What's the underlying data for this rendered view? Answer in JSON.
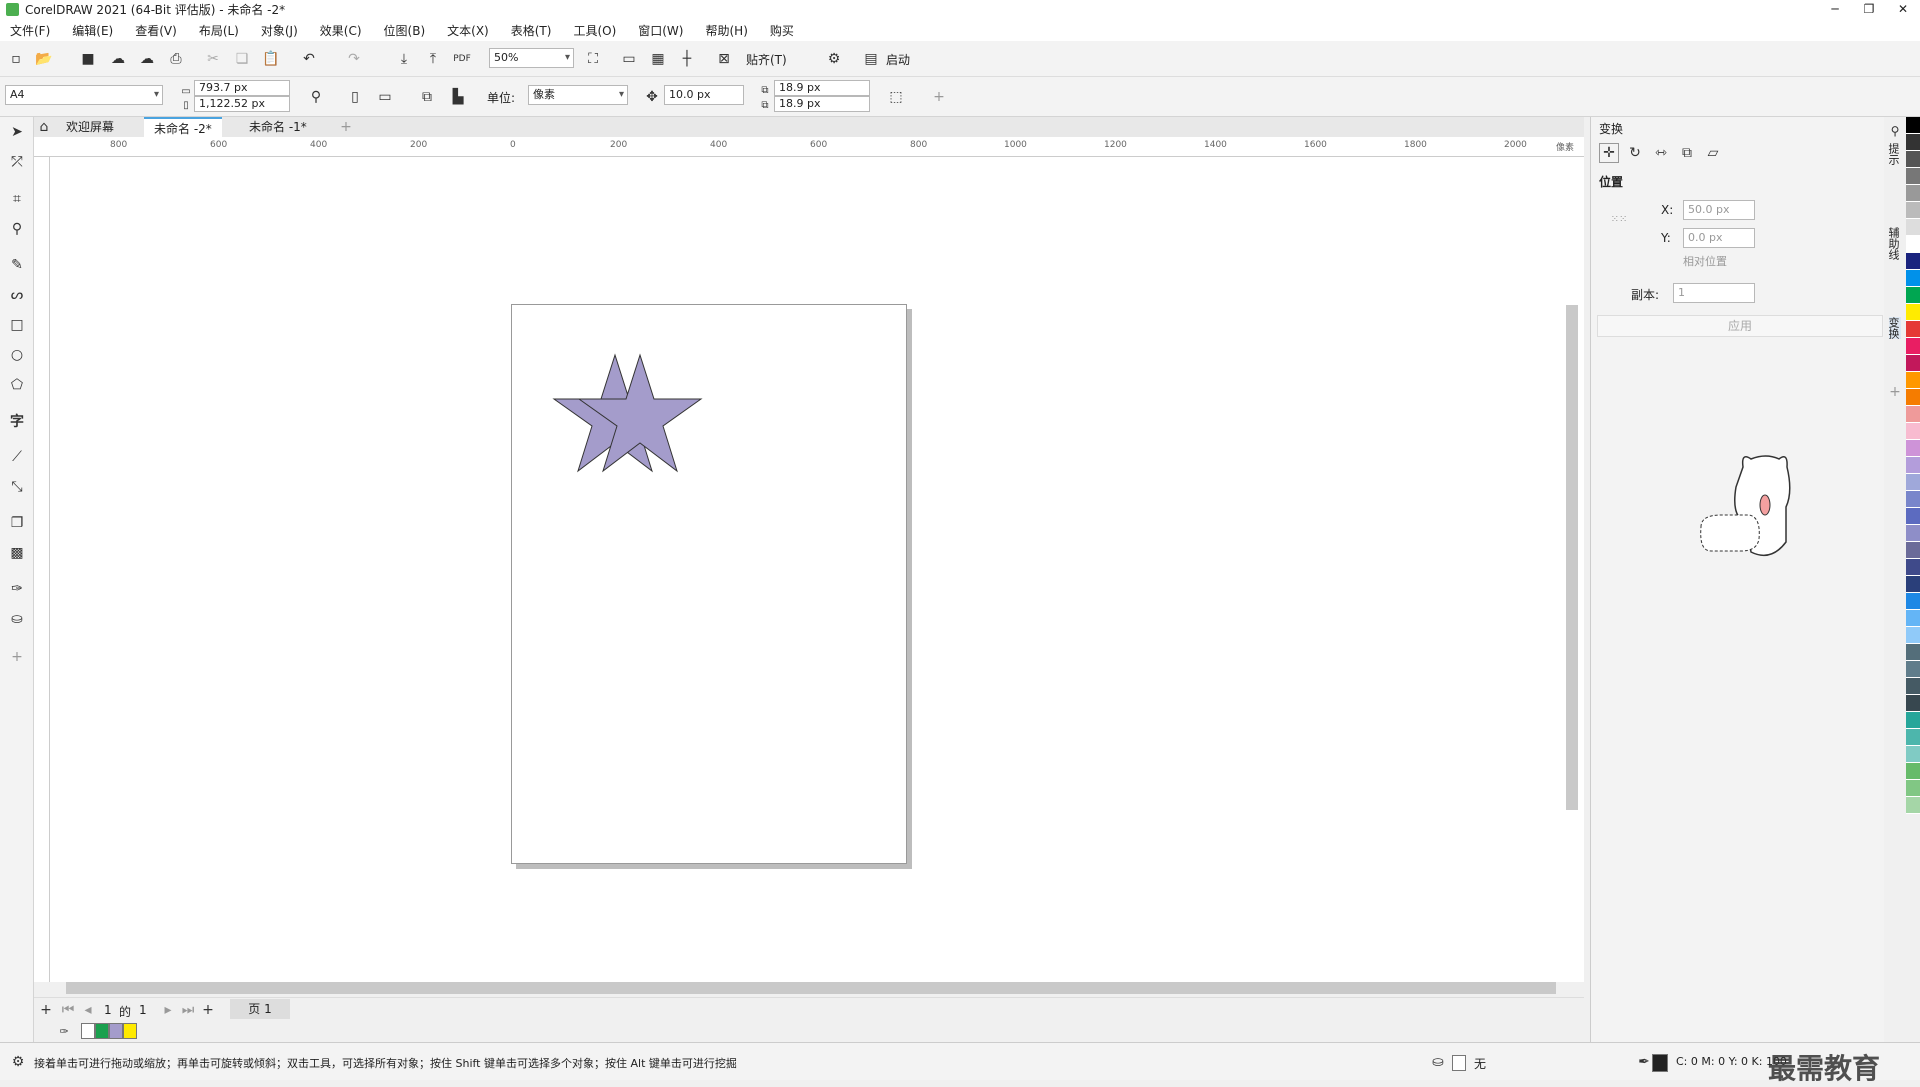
{
  "app": {
    "title": "CorelDRAW 2021 (64-Bit 评估版) - 未命名 -2*"
  },
  "menu": [
    "文件(F)",
    "编辑(E)",
    "查看(V)",
    "布局(L)",
    "对象(J)",
    "效果(C)",
    "位图(B)",
    "文本(X)",
    "表格(T)",
    "工具(O)",
    "窗口(W)",
    "帮助(H)",
    "购买"
  ],
  "toolbar": {
    "zoom": "50%",
    "snap_label": "贴齐(T)",
    "launch_label": "启动"
  },
  "propbar": {
    "page_size": "A4",
    "width": "793.7 px",
    "height": "1,122.52 px",
    "units_label": "单位:",
    "units": "像素",
    "nudge": "10.0 px",
    "dup_x": "18.9 px",
    "dup_y": "18.9 px"
  },
  "tabs": [
    {
      "label": "欢迎屏幕"
    },
    {
      "label": "未命名 -2*"
    },
    {
      "label": "未命名 -1*"
    }
  ],
  "ruler": {
    "h_labels": [
      "800",
      "600",
      "400",
      "200",
      "0",
      "200",
      "400",
      "600",
      "800",
      "1000",
      "1200",
      "1400",
      "1600",
      "1800",
      "2000"
    ],
    "unit": "像素"
  },
  "pager": {
    "current": "1",
    "of": "的",
    "total": "1",
    "page_tab": "页 1"
  },
  "docker": {
    "title": "变换",
    "section": "位置",
    "x_label": "X:",
    "x_value": "50.0 px",
    "y_label": "Y:",
    "y_value": "0.0 px",
    "relative": "相对位置",
    "copies_label": "副本:",
    "copies_value": "1",
    "apply": "应用"
  },
  "side_tabs": [
    "提示",
    "辅助线",
    "变换"
  ],
  "status": {
    "hint": "接着单击可进行拖动或缩放；再单击可旋转或倾斜；双击工具，可选择所有对象；按住 Shift 键单击可选择多个对象；按住 Alt 键单击可进行挖掘",
    "fill_none": "无",
    "cmyk": "C: 0 M: 0 Y: 0 K: 100"
  },
  "doc_palette": [
    "#1aa04e",
    "#a49ccb",
    "#ffea00"
  ],
  "palette": [
    "#000000",
    "#333333",
    "#555555",
    "#777777",
    "#999999",
    "#bbbbbb",
    "#dddddd",
    "#ffffff",
    "#1a237e",
    "#0091ea",
    "#00a651",
    "#ffeb00",
    "#e53935",
    "#e91e63",
    "#c2185b",
    "#ff9800",
    "#f57c00",
    "#ef9a9a",
    "#f8bbd0",
    "#ce93d8",
    "#b39ddb",
    "#9fa8da",
    "#7986cb",
    "#5c6bc0",
    "#8e8ec8",
    "#6b6b99",
    "#3f4a8a",
    "#2a3f7a",
    "#1e88e5",
    "#64b5f6",
    "#90caf9",
    "#546e7a",
    "#607d8b",
    "#455a64",
    "#37474f",
    "#26a69a",
    "#4db6ac",
    "#80cbc4",
    "#66bb6a",
    "#81c784",
    "#a5d6a7"
  ],
  "star_color": "#a49ccb",
  "watermark": "最需教育"
}
